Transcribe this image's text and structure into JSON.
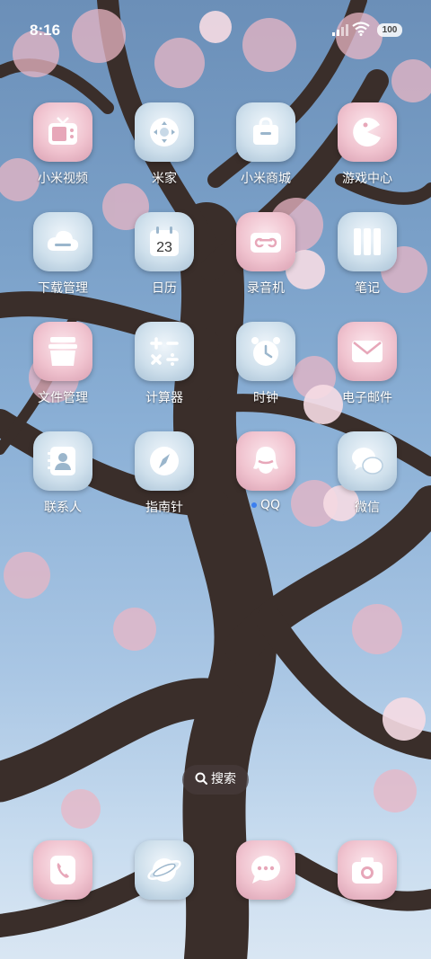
{
  "status": {
    "time": "8:16",
    "battery": "100"
  },
  "apps": [
    {
      "label": "小米视频",
      "icon": "tv-icon",
      "tint": "pink"
    },
    {
      "label": "米家",
      "icon": "dpad-icon",
      "tint": "blue"
    },
    {
      "label": "小米商城",
      "icon": "shop-icon",
      "tint": "blue"
    },
    {
      "label": "游戏中心",
      "icon": "pacman-icon",
      "tint": "pink"
    },
    {
      "label": "下载管理",
      "icon": "cloud-icon",
      "tint": "blue"
    },
    {
      "label": "日历",
      "icon": "calendar-icon",
      "tint": "blue",
      "badge": "23"
    },
    {
      "label": "录音机",
      "icon": "tape-icon",
      "tint": "pink"
    },
    {
      "label": "笔记",
      "icon": "notes-icon",
      "tint": "blue"
    },
    {
      "label": "文件管理",
      "icon": "folder-icon",
      "tint": "pink"
    },
    {
      "label": "计算器",
      "icon": "calculator-icon",
      "tint": "blue"
    },
    {
      "label": "时钟",
      "icon": "clock-icon",
      "tint": "blue"
    },
    {
      "label": "电子邮件",
      "icon": "mail-icon",
      "tint": "pink"
    },
    {
      "label": "联系人",
      "icon": "contacts-icon",
      "tint": "blue"
    },
    {
      "label": "指南针",
      "icon": "compass-icon",
      "tint": "blue"
    },
    {
      "label": "QQ",
      "icon": "qq-icon",
      "tint": "pink"
    },
    {
      "label": "微信",
      "icon": "wechat-icon",
      "tint": "blue"
    }
  ],
  "search": {
    "label": "搜索"
  },
  "dock": [
    {
      "icon": "phone-icon",
      "tint": "pink"
    },
    {
      "icon": "browser-icon",
      "tint": "blue"
    },
    {
      "icon": "message-icon",
      "tint": "pink"
    },
    {
      "icon": "camera-icon",
      "tint": "pink"
    }
  ]
}
